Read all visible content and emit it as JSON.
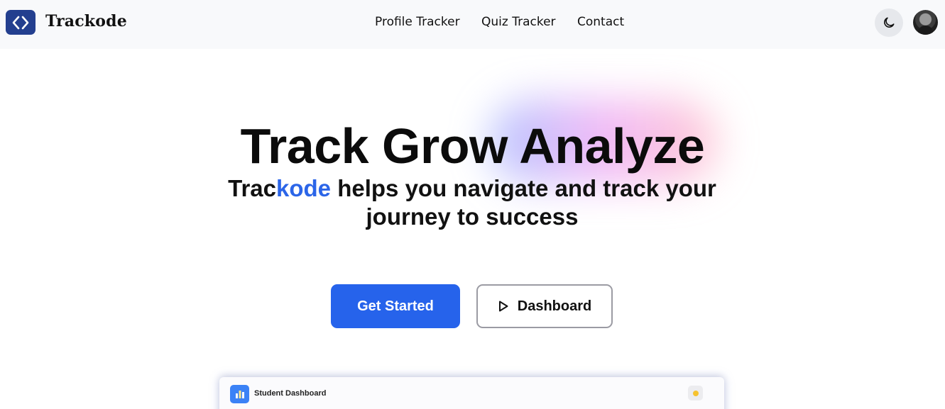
{
  "brand": {
    "name": "Trackode",
    "logo_icon": "code-brackets-icon",
    "logo_color": "#233f8f"
  },
  "nav": {
    "links": [
      {
        "label": "Profile Tracker"
      },
      {
        "label": "Quiz Tracker"
      },
      {
        "label": "Contact"
      }
    ],
    "theme_toggle_icon": "moon-icon",
    "avatar_icon": "user-avatar"
  },
  "hero": {
    "title": "Track Grow Analyze",
    "subtitle_prefix": "Trac",
    "subtitle_accent": "kode",
    "subtitle_rest": " helps you navigate and track your journey to success",
    "accent_color": "#2b65e8"
  },
  "actions": {
    "primary_label": "Get Started",
    "primary_color": "#2663eb",
    "secondary_label": "Dashboard",
    "secondary_icon": "play-icon"
  },
  "preview": {
    "title": "Student Dashboard",
    "app_icon": "bar-chart-icon",
    "status_icon": "status-dot-icon",
    "status_color": "#f6c22f"
  }
}
